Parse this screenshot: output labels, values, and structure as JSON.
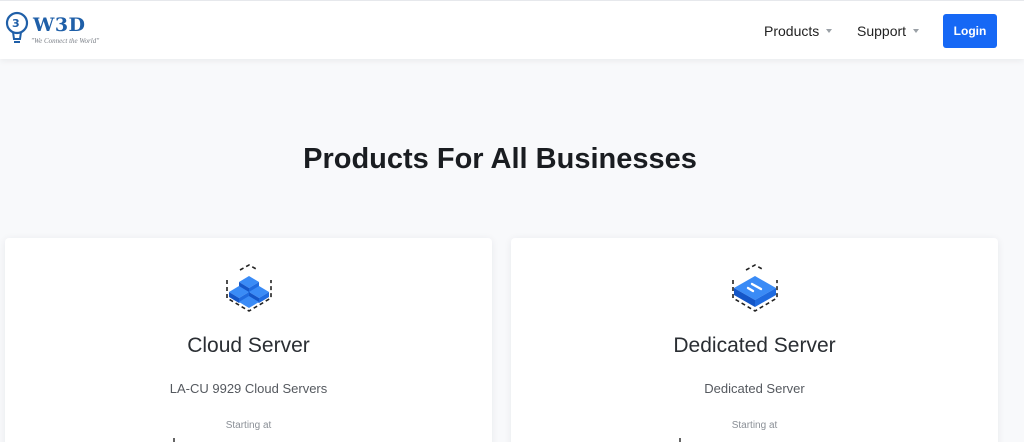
{
  "brand": {
    "name": "W3D",
    "tagline": "\"We Connect the World\"",
    "color": "#1f5fa8"
  },
  "nav": {
    "items": [
      {
        "label": "Products"
      },
      {
        "label": "Support"
      }
    ],
    "login_label": "Login",
    "accent": "#1668f5"
  },
  "main": {
    "heading": "Products For All Businesses",
    "cards": [
      {
        "icon": "cloud-server-icon",
        "title": "Cloud Server",
        "subtitle": "LA-CU 9929 Cloud Servers",
        "starting_label": "Starting at"
      },
      {
        "icon": "dedicated-server-icon",
        "title": "Dedicated Server",
        "subtitle": "Dedicated Server",
        "starting_label": "Starting at"
      }
    ]
  }
}
